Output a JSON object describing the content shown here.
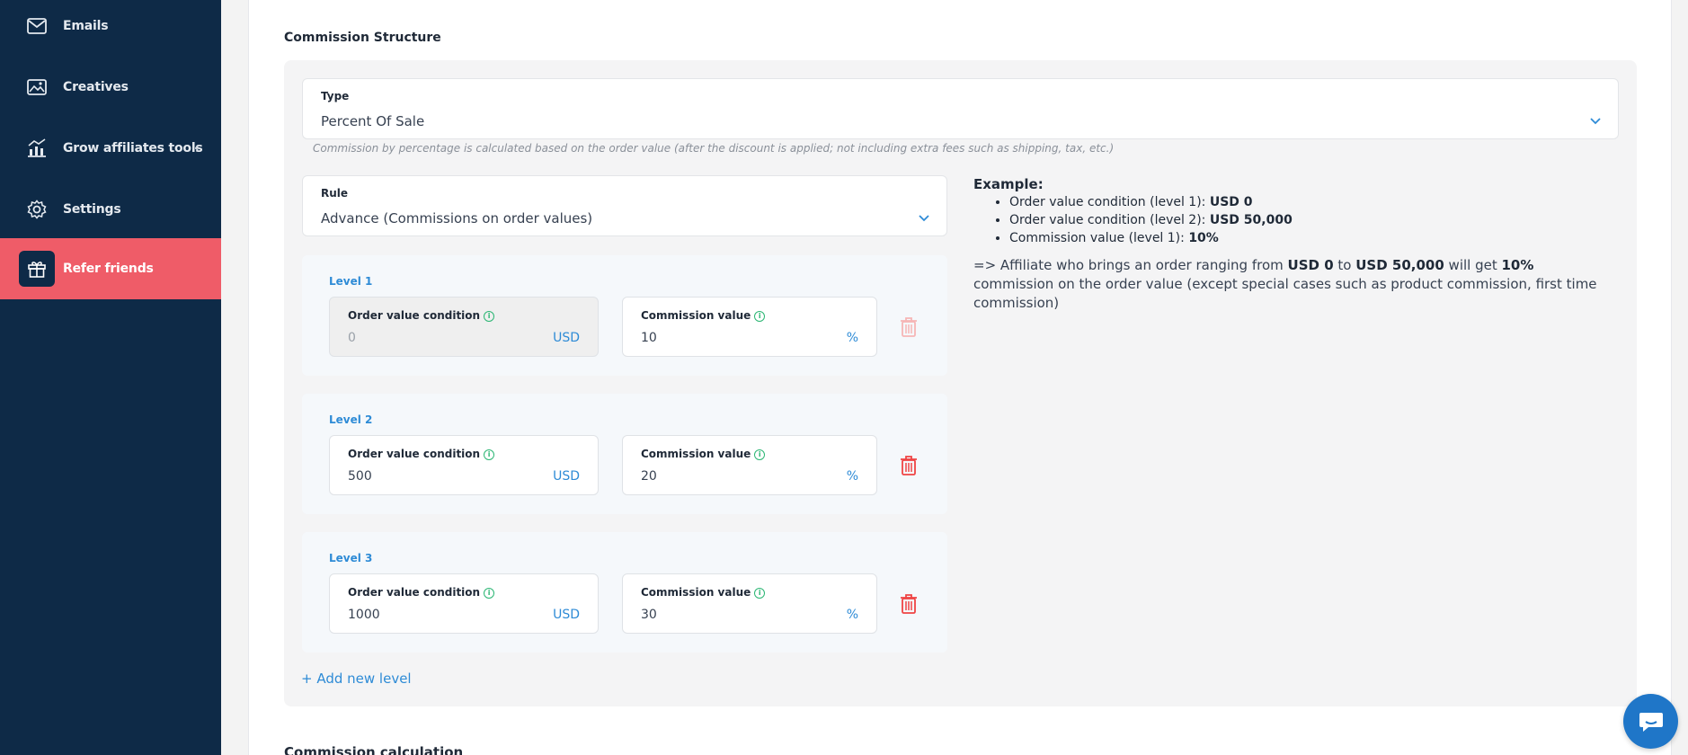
{
  "sidebar": {
    "items": [
      {
        "label": "Emails",
        "icon": "mail-icon"
      },
      {
        "label": "Creatives",
        "icon": "image-icon"
      },
      {
        "label": "Grow affiliates tools",
        "icon": "chart-icon"
      },
      {
        "label": "Settings",
        "icon": "gear-icon"
      },
      {
        "label": "Refer friends",
        "icon": "gift-icon",
        "active": true
      }
    ],
    "chevron": "‹"
  },
  "commission": {
    "section_title": "Commission Structure",
    "type": {
      "label": "Type",
      "value": "Percent Of Sale"
    },
    "hint": "Commission by percentage is calculated based on the order value (after the discount is applied; not including extra fees such as shipping, tax, etc.)",
    "rule": {
      "label": "Rule",
      "value": "Advance (Commissions on order values)"
    },
    "levels": [
      {
        "title": "Level 1",
        "order_label": "Order value condition",
        "order_value": "0",
        "order_unit": "USD",
        "comm_label": "Commission value",
        "comm_value": "10",
        "comm_unit": "%"
      },
      {
        "title": "Level 2",
        "order_label": "Order value condition",
        "order_value": "500",
        "order_unit": "USD",
        "comm_label": "Commission value",
        "comm_value": "20",
        "comm_unit": "%"
      },
      {
        "title": "Level 3",
        "order_label": "Order value condition",
        "order_value": "1000",
        "order_unit": "USD",
        "comm_label": "Commission value",
        "comm_value": "30",
        "comm_unit": "%"
      }
    ],
    "add_level": "+ Add new level",
    "example": {
      "title": "Example:",
      "items": [
        {
          "text": "Order value condition (level 1): ",
          "bold": "USD 0"
        },
        {
          "text": "Order value condition (level 2): ",
          "bold": "USD 50,000"
        },
        {
          "text": "Commission value (level 1): ",
          "bold": "10%"
        }
      ],
      "note_prefix": "=> Affiliate who brings an order ranging from ",
      "note_from": "USD 0",
      "note_to_word": " to ",
      "note_to": "USD 50,000",
      "note_get": " will get ",
      "note_pct": "10%",
      "note_suffix": " commission on the order value (except special cases such as product commission, first time commission)"
    },
    "bottom_title": "Commission calculation"
  },
  "colors": {
    "sidebar_bg": "#0e2a47",
    "active_bg": "#ef5c68",
    "accent": "#2e8bd6",
    "danger": "#ef4444"
  }
}
